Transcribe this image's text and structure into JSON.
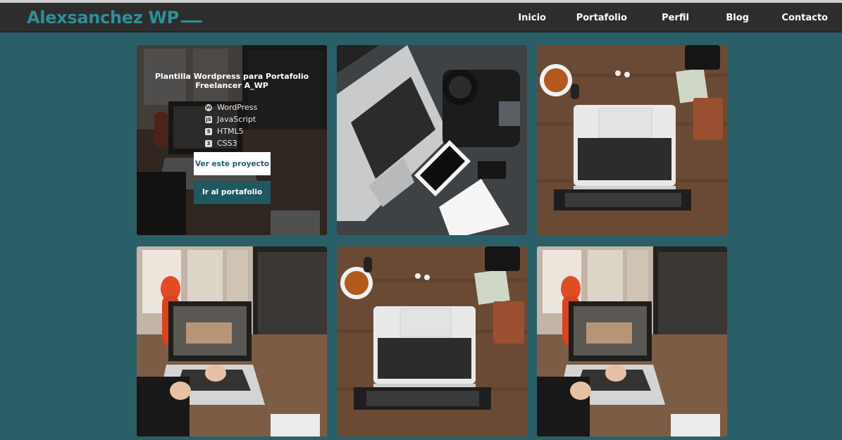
{
  "header": {
    "logo": "Alexsanchez WP",
    "nav": [
      "Inicio",
      "Portafolio",
      "Perfil",
      "Blog",
      "Contacto"
    ]
  },
  "colors": {
    "background": "#2b5f68",
    "header": "#2d2d2d",
    "logo": "#2f8f98",
    "button_dark": "#1f5860"
  },
  "featured": {
    "title": "Plantilla Wordpress para Portafolio Freelancer A_WP",
    "technologies": [
      {
        "name": "WordPress",
        "icon": "wordpress-icon"
      },
      {
        "name": "JavaScript",
        "icon": "javascript-icon"
      },
      {
        "name": "HTML5",
        "icon": "html5-icon"
      },
      {
        "name": "CSS3",
        "icon": "css3-icon"
      }
    ],
    "primary_button": "Ver este proyecto",
    "secondary_button": "Ir al portafolio"
  },
  "tiles": [
    {
      "photo": "desk-imac-laptop-photo"
    },
    {
      "photo": "laptop-camera-phone-photo"
    },
    {
      "photo": "macbook-coffee-top-view-photo"
    },
    {
      "photo": "desk-imac-laptop-photo"
    },
    {
      "photo": "macbook-coffee-top-view-photo"
    },
    {
      "photo": "desk-imac-laptop-photo"
    }
  ]
}
